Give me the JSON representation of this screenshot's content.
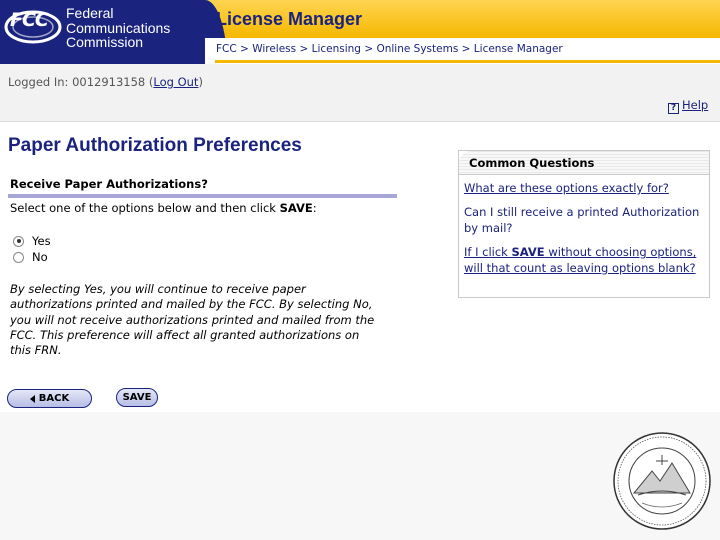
{
  "header": {
    "fcc_logo": "FCC",
    "org_name": [
      "Federal",
      "Communications",
      "Commission"
    ],
    "app_title": "License Manager",
    "breadcrumb": [
      "FCC",
      "Wireless",
      "Licensing",
      "Online Systems",
      "License Manager"
    ],
    "breadcrumb_sep": ">"
  },
  "session": {
    "logged_in_label": "Logged In: 0012913158 (",
    "logout_label": "Log Out",
    "logged_in_close": ")",
    "help_label": "Help",
    "help_icon": "question-mark-icon"
  },
  "main": {
    "page_title": "Paper Authorization Preferences",
    "section_title": "Receive Paper Authorizations?",
    "instruction_pre": "Select one of the options below and then click ",
    "instruction_bold": "SAVE",
    "instruction_post": ":",
    "options": [
      {
        "label": "Yes",
        "selected": true
      },
      {
        "label": "No",
        "selected": false
      }
    ],
    "explanation": "By selecting Yes, you will continue to receive paper authorizations printed and mailed by the FCC. By selecting No, you will not receive authorizations printed and mailed from the FCC. This preference will affect all granted authorizations on this FRN.",
    "back_label": "BACK",
    "save_label": "SAVE"
  },
  "common_questions": {
    "title": "Common Questions",
    "items": [
      {
        "text": "What are these options exactly for?",
        "link": true
      },
      {
        "text": "Can I still receive a printed Authorization by mail?",
        "link": false
      },
      {
        "pre": "If I click ",
        "bold": "SAVE",
        "post": " without choosing options, will that count as leaving options blank?",
        "link": true
      }
    ]
  },
  "colors": {
    "brand_navy": "#1a237e",
    "title_gold": "#f5b800"
  }
}
